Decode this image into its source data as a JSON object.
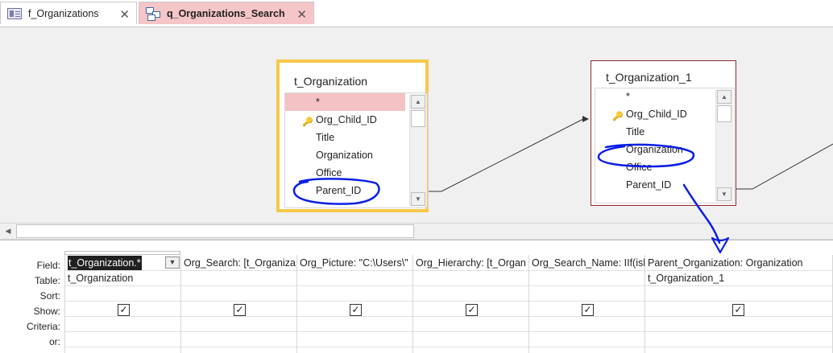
{
  "tabs": [
    {
      "label": "f_Organizations",
      "icon": "form-icon",
      "active": false
    },
    {
      "label": "q_Organizations_Search",
      "icon": "query-icon",
      "active": true
    }
  ],
  "tables": {
    "t_organization": {
      "title": "t_Organization",
      "fields": [
        "*",
        "Org_Child_ID",
        "Title",
        "Organization",
        "Office",
        "Parent_ID"
      ],
      "key_field": "Org_Child_ID",
      "selected_field": "*"
    },
    "t_organization_1": {
      "title": "t_Organization_1",
      "fields": [
        "*",
        "Org_Child_ID",
        "Title",
        "Organization",
        "Office",
        "Parent_ID"
      ],
      "key_field": "Org_Child_ID"
    }
  },
  "grid": {
    "row_labels": {
      "field": "Field:",
      "table": "Table:",
      "sort": "Sort:",
      "show": "Show:",
      "criteria": "Criteria:",
      "or": "or:"
    },
    "columns": [
      {
        "field": "t_Organization.*",
        "table": "t_Organization",
        "show": true
      },
      {
        "field": "Org_Search: [t_Organiza",
        "table": "",
        "show": true
      },
      {
        "field": "Org_Picture: \"C:\\Users\\\"",
        "table": "",
        "show": true
      },
      {
        "field": "Org_Hierarchy: [t_Organ",
        "table": "",
        "show": true
      },
      {
        "field": "Org_Search_Name: IIf(isl",
        "table": "",
        "show": true
      },
      {
        "field": "Parent_Organization: Organization",
        "table": "t_Organization_1",
        "show": true
      }
    ]
  },
  "colors": {
    "active_tab": "#f5c5c8",
    "selected_table_border": "#f5c84a",
    "table_border": "#8b2b2b",
    "annotation_ink": "#0a1ee6"
  }
}
